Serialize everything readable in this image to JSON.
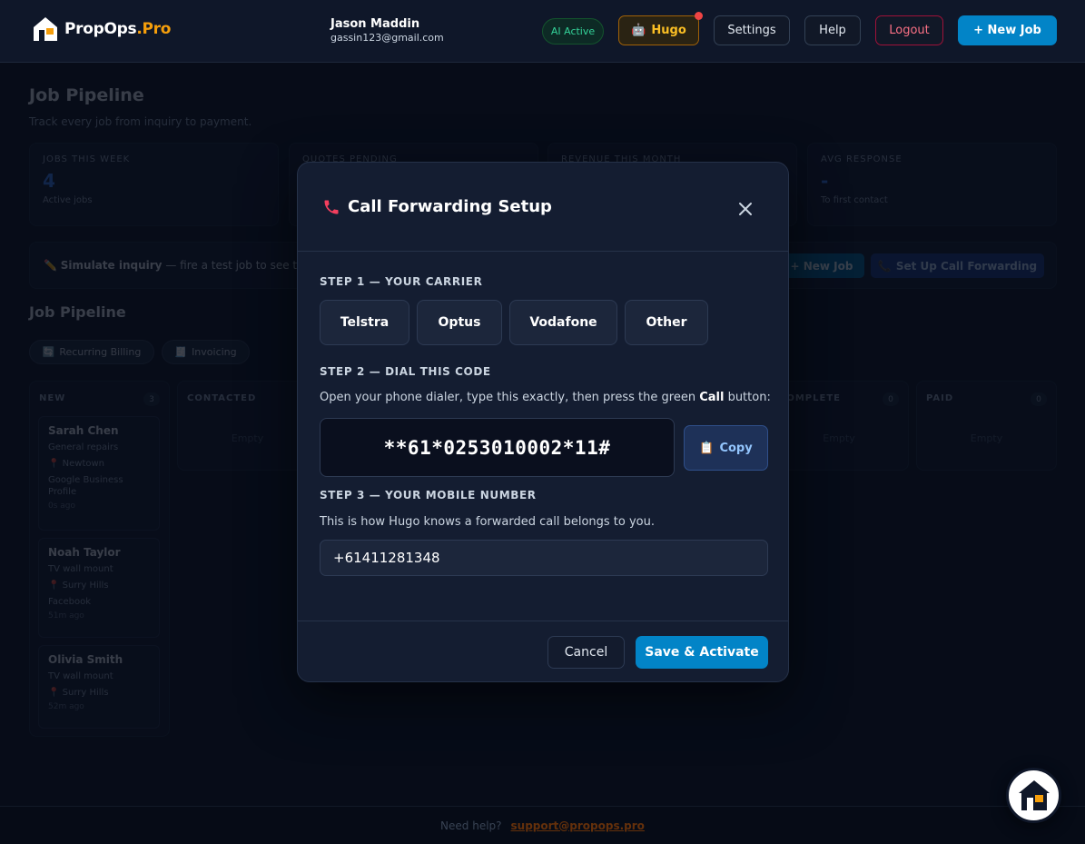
{
  "brand": {
    "name": "PropOps",
    "suffix": ".Pro"
  },
  "user": {
    "name": "Jason Maddin",
    "email": "gassin123@gmail.com"
  },
  "header": {
    "ai_status": "AI Active",
    "hugo_label": "Hugo",
    "settings_label": "Settings",
    "help_label": "Help",
    "logout_label": "Logout",
    "new_job_label": "+ New Job"
  },
  "page": {
    "title": "Job Pipeline",
    "subtitle": "Track every job from inquiry to payment.",
    "stats": [
      {
        "label": "JOBS THIS WEEK",
        "value": "4",
        "note": "Active jobs"
      },
      {
        "label": "QUOTES PENDING",
        "value": "",
        "note": ""
      },
      {
        "label": "REVENUE THIS MONTH",
        "value": "",
        "note": ""
      },
      {
        "label": "AVG RESPONSE",
        "value": "-",
        "note": "To first contact"
      }
    ],
    "simulate": {
      "title": "Simulate inquiry",
      "text": "— fire a test job to see the p",
      "new_job_label": "+ New Job",
      "forward_label": "Set Up Call Forwarding"
    },
    "section_title": "Job Pipeline",
    "chips": [
      "Recurring Billing",
      "Invoicing"
    ],
    "columns": [
      {
        "name": "NEW",
        "count": "3"
      },
      {
        "name": "CONTACTED",
        "count": "",
        "empty": "Empty"
      },
      {
        "name": "COMPLETE",
        "count": "0",
        "empty": "Empty"
      },
      {
        "name": "PAID",
        "count": "0",
        "empty": "Empty"
      }
    ],
    "cards": [
      {
        "name": "Sarah Chen",
        "service": "General repairs",
        "location": "Newtown",
        "source": "Google Business Profile",
        "time": "0s ago"
      },
      {
        "name": "Noah Taylor",
        "service": "TV wall mount",
        "location": "Surry Hills",
        "source": "Facebook",
        "time": "51m ago"
      },
      {
        "name": "Olivia Smith",
        "service": "TV wall mount",
        "location": "Surry Hills",
        "source": "",
        "time": "52m ago"
      }
    ]
  },
  "footer": {
    "text": "Need help?",
    "link": "support@propops.pro"
  },
  "modal": {
    "title": "Call Forwarding Setup",
    "step1_label": "STEP 1 — YOUR CARRIER",
    "carriers": [
      "Telstra",
      "Optus",
      "Vodafone",
      "Other"
    ],
    "step2_label": "STEP 2 — DIAL THIS CODE",
    "step2_desc_pre": "Open your phone dialer, type this exactly, then press the green ",
    "step2_desc_bold": "Call",
    "step2_desc_post": " button:",
    "dial_code": "**61*0253010002*11#",
    "copy_label": "Copy",
    "step3_label": "STEP 3 — YOUR MOBILE NUMBER",
    "step3_desc": "This is how Hugo knows a forwarded call belongs to you.",
    "mobile_value": "+61411281348",
    "cancel_label": "Cancel",
    "save_label": "Save & Activate"
  },
  "colors": {
    "accent": "#0284c7",
    "brand_orange": "#f59e0b",
    "background": "#0b1120",
    "danger": "#fb7185",
    "success": "#34d399"
  }
}
